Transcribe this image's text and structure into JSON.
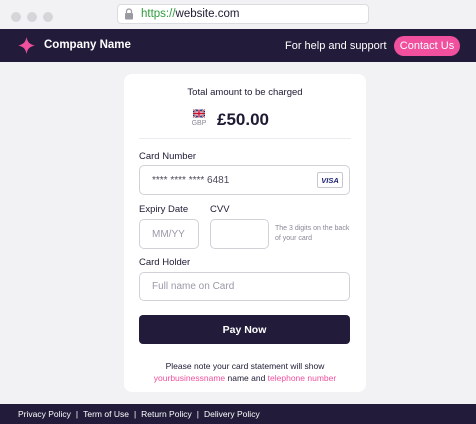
{
  "browser": {
    "url_scheme": "https://",
    "url_host": "website.com"
  },
  "header": {
    "company_name": "Company Name",
    "help_text": "For help and support",
    "contact_label": "Contact Us"
  },
  "payment": {
    "total_label": "Total amount to be charged",
    "currency_code": "GBP",
    "amount": "£50.00",
    "card_number_label": "Card Number",
    "card_number_value": "**** **** **** 6481",
    "card_brand": "VISA",
    "expiry_label": "Expiry Date",
    "expiry_placeholder": "MM/YY",
    "cvv_label": "CVV",
    "cvv_hint": "The 3 digits on the back of your card",
    "holder_label": "Card Holder",
    "holder_placeholder": "Full name on Card",
    "pay_label": "Pay Now",
    "note_line1": "Please note your card statement will show",
    "note_business": "yourbusinessname",
    "note_mid": " name and ",
    "note_phone": "telephone number"
  },
  "footer": {
    "links": [
      "Privacy Policy",
      "Term of Use",
      "Return Policy",
      "Delivery Policy"
    ],
    "separator": "|"
  },
  "colors": {
    "brand_dark": "#221c3a",
    "accent_pink": "#f0509e",
    "url_green": "#2f9b3c"
  },
  "icons": [
    "lock-icon",
    "sparkle-logo-icon",
    "uk-flag-icon",
    "visa-card-icon"
  ]
}
